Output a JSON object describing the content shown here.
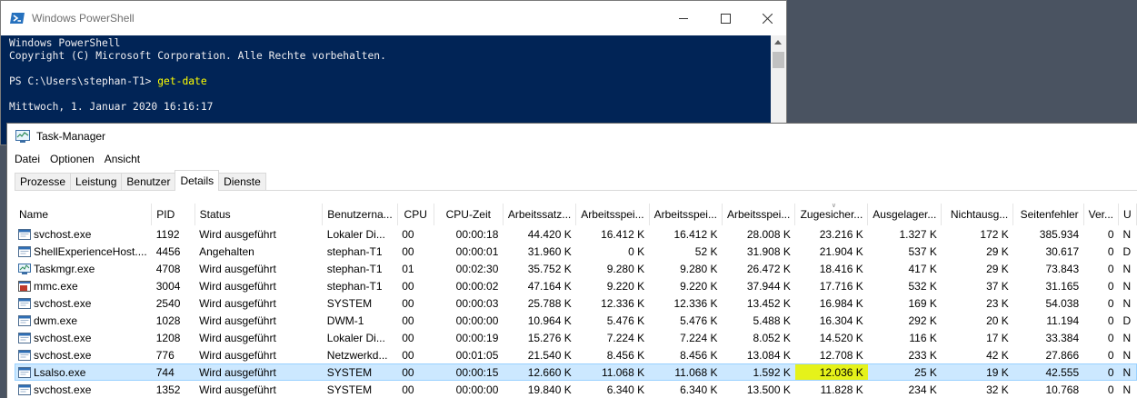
{
  "powershell": {
    "title": "Windows PowerShell",
    "lines": [
      "Windows PowerShell",
      "Copyright (C) Microsoft Corporation. Alle Rechte vorbehalten.",
      "",
      "",
      "",
      "Mittwoch, 1. Januar 2020 16:16:17"
    ],
    "prompt": "PS C:\\Users\\stephan-T1> ",
    "command": "get-date"
  },
  "taskmanager": {
    "title": "Task-Manager",
    "menu": [
      "Datei",
      "Optionen",
      "Ansicht"
    ],
    "tabs": [
      "Prozesse",
      "Leistung",
      "Benutzer",
      "Details",
      "Dienste"
    ],
    "active_tab": "Details",
    "columns": [
      "Name",
      "PID",
      "Status",
      "Benutzerna...",
      "CPU",
      "CPU-Zeit",
      "Arbeitssatz...",
      "Arbeitsspei...",
      "Arbeitsspei...",
      "Arbeitsspei...",
      "Zugesicher...",
      "Ausgelager...",
      "Nichtausg...",
      "Seitenfehler",
      "Ver...",
      "U"
    ],
    "rows": [
      {
        "icon": "service-icon",
        "cells": [
          "svchost.exe",
          "1192",
          "Wird ausgeführt",
          "Lokaler Di...",
          "00",
          "00:00:18",
          "44.420 K",
          "16.412 K",
          "16.412 K",
          "28.008 K",
          "23.216 K",
          "1.327 K",
          "172 K",
          "385.934",
          "0",
          "N"
        ]
      },
      {
        "icon": "service-icon",
        "cells": [
          "ShellExperienceHost....",
          "4456",
          "Angehalten",
          "stephan-T1",
          "00",
          "00:00:01",
          "31.960 K",
          "0 K",
          "52 K",
          "31.908 K",
          "21.904 K",
          "537 K",
          "29 K",
          "30.617",
          "0",
          "D"
        ]
      },
      {
        "icon": "taskmgr-icon",
        "cells": [
          "Taskmgr.exe",
          "4708",
          "Wird ausgeführt",
          "stephan-T1",
          "01",
          "00:02:30",
          "35.752 K",
          "9.280 K",
          "9.280 K",
          "26.472 K",
          "18.416 K",
          "417 K",
          "29 K",
          "73.843",
          "0",
          "N"
        ]
      },
      {
        "icon": "mmc-icon",
        "cells": [
          "mmc.exe",
          "3004",
          "Wird ausgeführt",
          "stephan-T1",
          "00",
          "00:00:02",
          "47.164 K",
          "9.220 K",
          "9.220 K",
          "37.944 K",
          "17.716 K",
          "532 K",
          "37 K",
          "31.165",
          "0",
          "N"
        ]
      },
      {
        "icon": "service-icon",
        "cells": [
          "svchost.exe",
          "2540",
          "Wird ausgeführt",
          "SYSTEM",
          "00",
          "00:00:03",
          "25.788 K",
          "12.336 K",
          "12.336 K",
          "13.452 K",
          "16.984 K",
          "169 K",
          "23 K",
          "54.038",
          "0",
          "N"
        ]
      },
      {
        "icon": "service-icon",
        "cells": [
          "dwm.exe",
          "1028",
          "Wird ausgeführt",
          "DWM-1",
          "00",
          "00:00:00",
          "10.964 K",
          "5.476 K",
          "5.476 K",
          "5.488 K",
          "16.304 K",
          "292 K",
          "20 K",
          "11.194",
          "0",
          "D"
        ]
      },
      {
        "icon": "service-icon",
        "cells": [
          "svchost.exe",
          "1208",
          "Wird ausgeführt",
          "Lokaler Di...",
          "00",
          "00:00:19",
          "15.276 K",
          "7.224 K",
          "7.224 K",
          "8.052 K",
          "14.520 K",
          "116 K",
          "17 K",
          "33.384",
          "0",
          "N"
        ]
      },
      {
        "icon": "service-icon",
        "cells": [
          "svchost.exe",
          "776",
          "Wird ausgeführt",
          "Netzwerkd...",
          "00",
          "00:01:05",
          "21.540 K",
          "8.456 K",
          "8.456 K",
          "13.084 K",
          "12.708 K",
          "233 K",
          "42 K",
          "27.866",
          "0",
          "N"
        ]
      },
      {
        "icon": "service-icon",
        "cells": [
          "Lsalso.exe",
          "744",
          "Wird ausgeführt",
          "SYSTEM",
          "00",
          "00:00:15",
          "12.660 K",
          "11.068 K",
          "11.068 K",
          "1.592 K",
          "12.036 K",
          "25 K",
          "19 K",
          "42.555",
          "0",
          "N"
        ],
        "selected": true,
        "highlight_col": 10
      },
      {
        "icon": "service-icon",
        "cells": [
          "svchost.exe",
          "1352",
          "Wird ausgeführt",
          "SYSTEM",
          "00",
          "00:00:00",
          "19.840 K",
          "6.340 K",
          "6.340 K",
          "13.500 K",
          "11.828 K",
          "234 K",
          "32 K",
          "10.768",
          "0",
          "N"
        ]
      }
    ]
  },
  "colors": {
    "console_bg": "#012456",
    "console_fg": "#eeedf0",
    "command": "#ffff00",
    "selection": "#cce8ff",
    "highlight": "#e5f21a",
    "desktop": "#4a5361"
  }
}
